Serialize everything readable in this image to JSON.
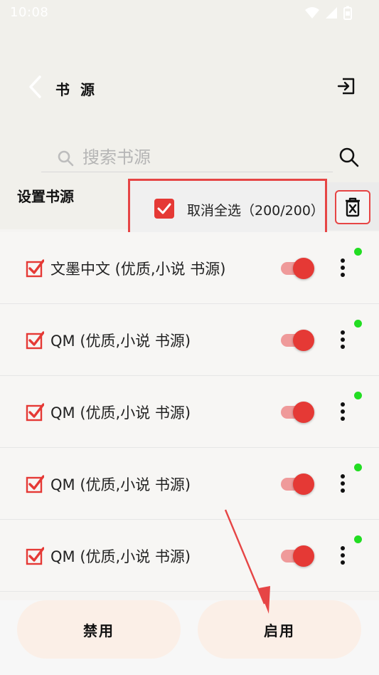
{
  "status_bar": {
    "time": "10:08",
    "icons": [
      "wifi-icon",
      "signal-icon",
      "battery-icon"
    ]
  },
  "header": {
    "title": "书 源",
    "back_icon": "chevron-left-icon",
    "export_icon": "export-icon"
  },
  "search": {
    "placeholder": "搜索书源",
    "value": ""
  },
  "section_title": "设置书源",
  "select_popup": {
    "label": "取消全选（200/200）",
    "checked": true
  },
  "sources": [
    {
      "name": "文墨中文 (优质,小说 书源)",
      "checked": true,
      "enabled": true,
      "online": true
    },
    {
      "name": "QM (优质,小说 书源)",
      "checked": true,
      "enabled": true,
      "online": true
    },
    {
      "name": "QM (优质,小说 书源)",
      "checked": true,
      "enabled": true,
      "online": true
    },
    {
      "name": "QM (优质,小说 书源)",
      "checked": true,
      "enabled": true,
      "online": true
    },
    {
      "name": "QM (优质,小说 书源)",
      "checked": true,
      "enabled": true,
      "online": true
    }
  ],
  "footer": {
    "disable_label": "禁用",
    "enable_label": "启用"
  },
  "colors": {
    "accent": "#e53935",
    "online_dot": "#22dd22",
    "button_bg": "#fbefe7"
  }
}
